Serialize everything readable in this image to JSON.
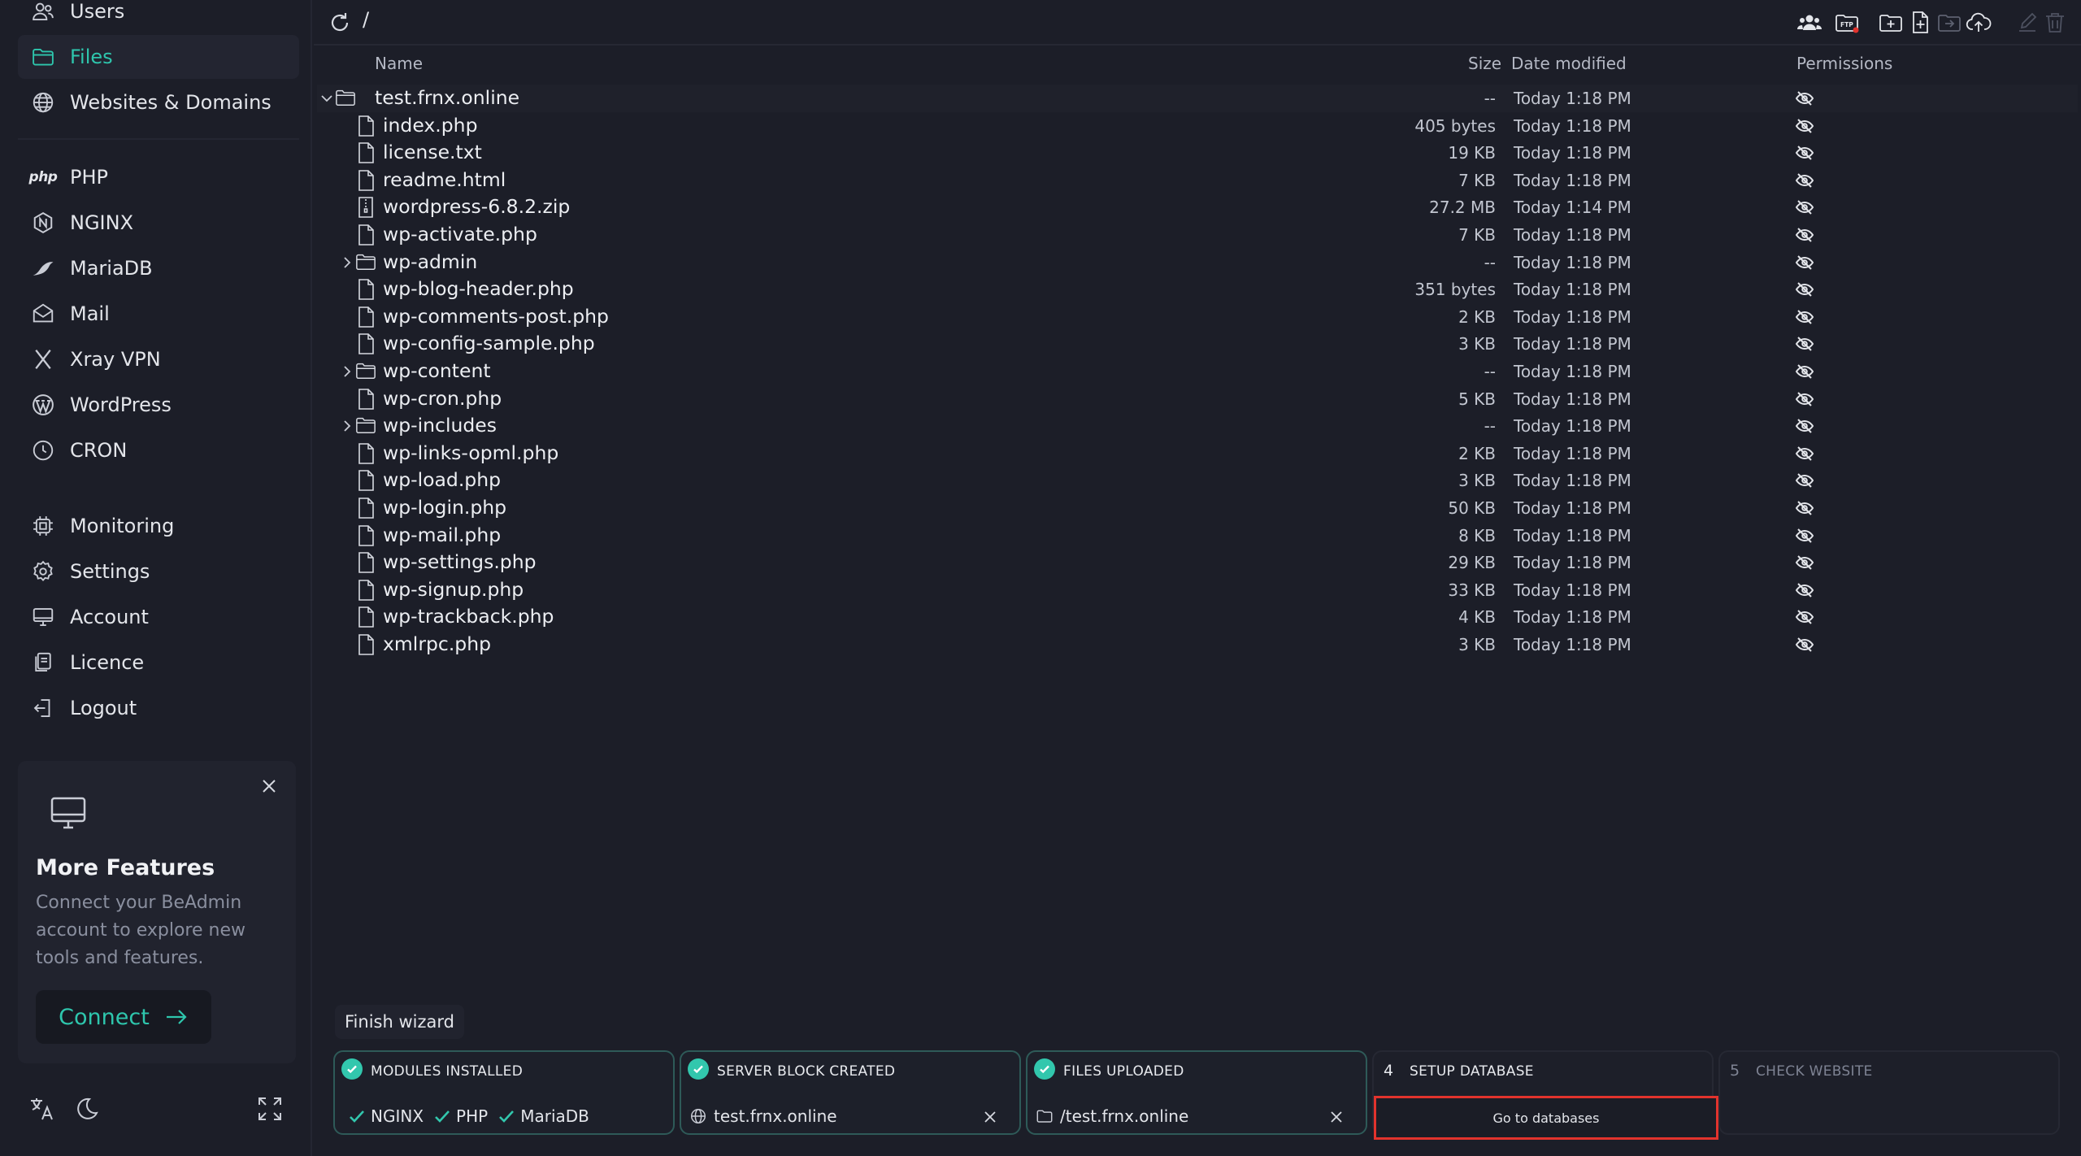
{
  "sidebar": {
    "items": [
      {
        "label": "Users",
        "icon": "users-icon"
      },
      {
        "label": "Files",
        "icon": "folder-icon",
        "active": true
      },
      {
        "label": "Websites & Domains",
        "icon": "globe-icon"
      },
      {
        "label": "PHP",
        "icon": "php-icon",
        "icon_text": "php"
      },
      {
        "label": "NGINX",
        "icon": "nginx-icon"
      },
      {
        "label": "MariaDB",
        "icon": "mariadb-icon"
      },
      {
        "label": "Mail",
        "icon": "mail-icon"
      },
      {
        "label": "Xray VPN",
        "icon": "xray-icon"
      },
      {
        "label": "WordPress",
        "icon": "wordpress-icon"
      },
      {
        "label": "CRON",
        "icon": "clock-icon"
      },
      {
        "label": "Monitoring",
        "icon": "cpu-icon"
      },
      {
        "label": "Settings",
        "icon": "gear-icon"
      },
      {
        "label": "Account",
        "icon": "monitor-icon"
      },
      {
        "label": "Licence",
        "icon": "licence-icon"
      },
      {
        "label": "Logout",
        "icon": "logout-icon"
      }
    ],
    "promo": {
      "title": "More Features",
      "text": "Connect your BeAdmin account to explore new tools and features.",
      "button": "Connect"
    }
  },
  "toolbar": {
    "path": "/",
    "ftp_label": "FTP"
  },
  "table": {
    "headers": {
      "name": "Name",
      "size": "Size",
      "date": "Date modified",
      "permissions": "Permissions"
    },
    "rows": [
      {
        "name": "test.frnx.online",
        "type": "folder",
        "expanded": true,
        "size": "--",
        "date": "Today 1:18 PM",
        "level": 0
      },
      {
        "name": "index.php",
        "type": "file",
        "size": "405 bytes",
        "date": "Today 1:18 PM",
        "level": 1
      },
      {
        "name": "license.txt",
        "type": "file",
        "size": "19 KB",
        "date": "Today 1:18 PM",
        "level": 1
      },
      {
        "name": "readme.html",
        "type": "file",
        "size": "7 KB",
        "date": "Today 1:18 PM",
        "level": 1
      },
      {
        "name": "wordpress-6.8.2.zip",
        "type": "zip",
        "size": "27.2 MB",
        "date": "Today 1:14 PM",
        "level": 1
      },
      {
        "name": "wp-activate.php",
        "type": "file",
        "size": "7 KB",
        "date": "Today 1:18 PM",
        "level": 1
      },
      {
        "name": "wp-admin",
        "type": "folder",
        "expanded": false,
        "size": "--",
        "date": "Today 1:18 PM",
        "level": 1
      },
      {
        "name": "wp-blog-header.php",
        "type": "file",
        "size": "351 bytes",
        "date": "Today 1:18 PM",
        "level": 1
      },
      {
        "name": "wp-comments-post.php",
        "type": "file",
        "size": "2 KB",
        "date": "Today 1:18 PM",
        "level": 1
      },
      {
        "name": "wp-config-sample.php",
        "type": "file",
        "size": "3 KB",
        "date": "Today 1:18 PM",
        "level": 1
      },
      {
        "name": "wp-content",
        "type": "folder",
        "expanded": false,
        "size": "--",
        "date": "Today 1:18 PM",
        "level": 1
      },
      {
        "name": "wp-cron.php",
        "type": "file",
        "size": "5 KB",
        "date": "Today 1:18 PM",
        "level": 1
      },
      {
        "name": "wp-includes",
        "type": "folder",
        "expanded": false,
        "size": "--",
        "date": "Today 1:18 PM",
        "level": 1
      },
      {
        "name": "wp-links-opml.php",
        "type": "file",
        "size": "2 KB",
        "date": "Today 1:18 PM",
        "level": 1
      },
      {
        "name": "wp-load.php",
        "type": "file",
        "size": "3 KB",
        "date": "Today 1:18 PM",
        "level": 1
      },
      {
        "name": "wp-login.php",
        "type": "file",
        "size": "50 KB",
        "date": "Today 1:18 PM",
        "level": 1
      },
      {
        "name": "wp-mail.php",
        "type": "file",
        "size": "8 KB",
        "date": "Today 1:18 PM",
        "level": 1
      },
      {
        "name": "wp-settings.php",
        "type": "file",
        "size": "29 KB",
        "date": "Today 1:18 PM",
        "level": 1
      },
      {
        "name": "wp-signup.php",
        "type": "file",
        "size": "33 KB",
        "date": "Today 1:18 PM",
        "level": 1
      },
      {
        "name": "wp-trackback.php",
        "type": "file",
        "size": "4 KB",
        "date": "Today 1:18 PM",
        "level": 1
      },
      {
        "name": "xmlrpc.php",
        "type": "file",
        "size": "3 KB",
        "date": "Today 1:18 PM",
        "level": 1
      }
    ]
  },
  "wizard": {
    "label": "Finish wizard",
    "steps": [
      {
        "title": "MODULES INSTALLED",
        "status": "done",
        "modules": [
          "NGINX",
          "PHP",
          "MariaDB"
        ]
      },
      {
        "title": "SERVER BLOCK CREATED",
        "status": "done",
        "value": "test.frnx.online"
      },
      {
        "title": "FILES UPLOADED",
        "status": "done",
        "value": "/test.frnx.online"
      },
      {
        "number": "4",
        "title": "SETUP DATABASE",
        "status": "current",
        "button": "Go to databases"
      },
      {
        "number": "5",
        "title": "CHECK WEBSITE",
        "status": "pending"
      }
    ]
  },
  "colors": {
    "accent": "#2ec6ad",
    "background": "#1c1e28",
    "highlight": "#e2332d"
  }
}
